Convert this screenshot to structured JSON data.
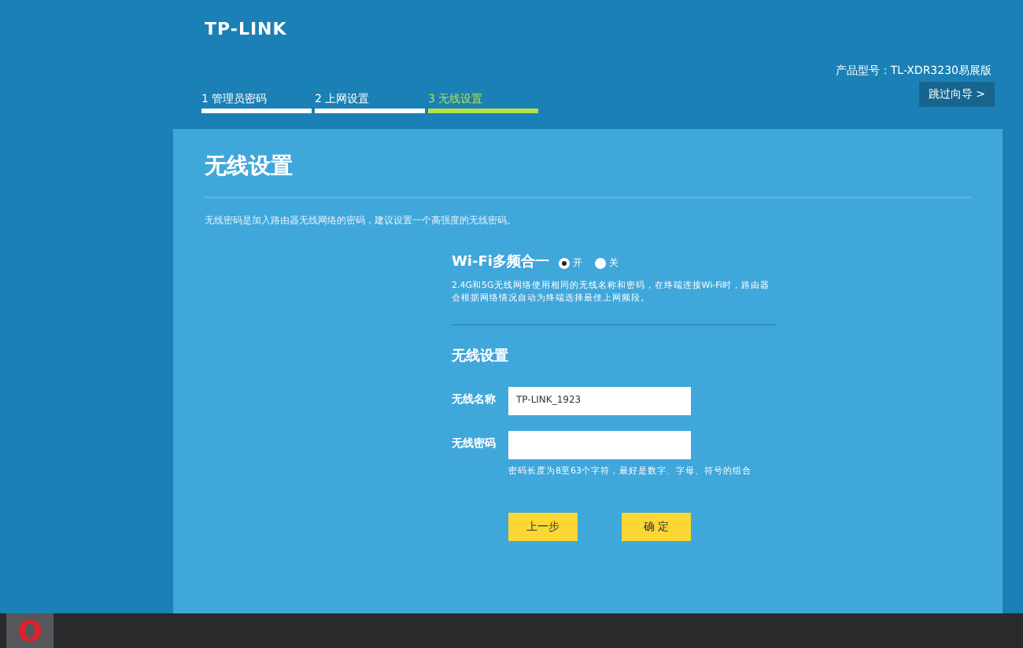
{
  "header": {
    "logo": "TP-LINK",
    "model": "产品型号：TL-XDR3230易展版"
  },
  "steps": [
    {
      "label": "1 管理员密码",
      "selected": false
    },
    {
      "label": "2 上网设置",
      "selected": false
    },
    {
      "label": "3 无线设置",
      "selected": true
    }
  ],
  "skip_button": "跳过向导 >",
  "panel": {
    "title": "无线设置",
    "description": "无线密码是加入路由器无线网络的密码，建议设置一个高强度的无线密码。",
    "multiband": {
      "label": "Wi-Fi多频合一",
      "options": [
        {
          "label": "开",
          "selected": true
        },
        {
          "label": "关",
          "selected": false
        }
      ],
      "note": "2.4G和5G无线网络使用相同的无线名称和密码，在终端连接Wi-Fi时，路由器会根据网络情况自动为终端选择最佳上网频段。"
    },
    "section_title": "无线设置",
    "fields": [
      {
        "label": "无线名称",
        "value": "TP-LINK_1923"
      },
      {
        "label": "无线密码"
      }
    ],
    "password_hint": "密码长度为8至63个字符，最好是数字、字母、符号的组合",
    "buttons": [
      "上一步",
      "确 定"
    ]
  },
  "taskbar": {
    "apps": [
      {
        "kind": "browser",
        "selected": true
      }
    ]
  }
}
